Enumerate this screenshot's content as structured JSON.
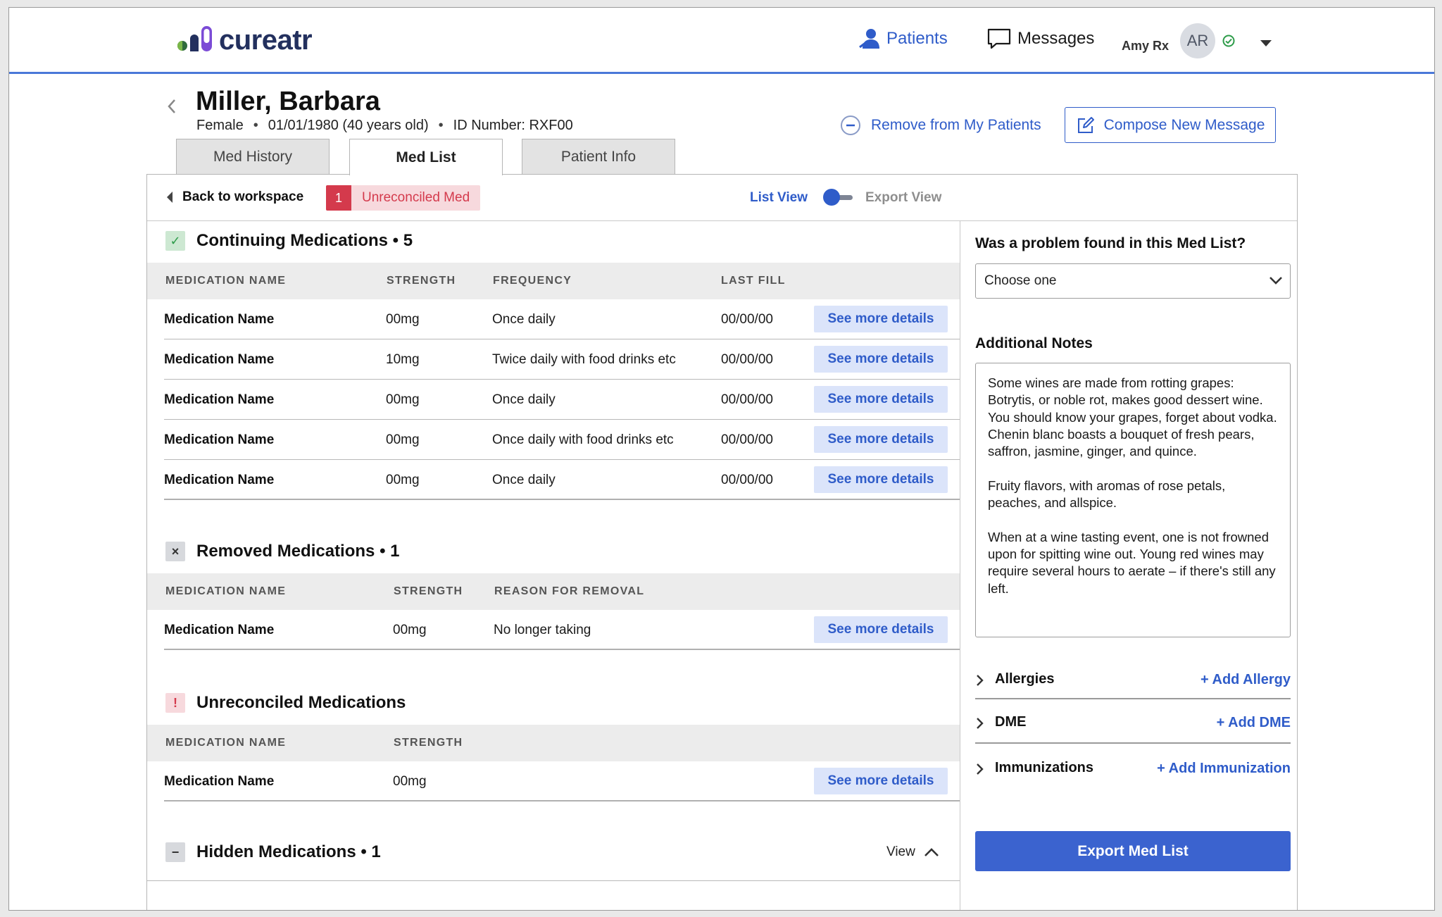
{
  "brand": {
    "name": "cureatr"
  },
  "nav": {
    "patients": "Patients",
    "messages": "Messages",
    "user_name": "Amy Rx",
    "avatar_initials": "AR",
    "status_color": "#2e9c4a"
  },
  "patient": {
    "name": "Miller, Barbara",
    "sex": "Female",
    "dob": "01/01/1980 (40 years old)",
    "id": "ID Number: RXF00",
    "remove_label": "Remove from My Patients",
    "compose_label": "Compose New Message"
  },
  "tabs": [
    {
      "label": "Med History",
      "active": false
    },
    {
      "label": "Med List",
      "active": true
    },
    {
      "label": "Patient Info",
      "active": false
    }
  ],
  "toolbar": {
    "back_label": "Back to workspace",
    "unreconciled_count": "1",
    "unreconciled_label": "Unreconciled Med",
    "list_view": "List View",
    "export_view": "Export View"
  },
  "continuing": {
    "title": "Continuing Medications • 5",
    "headers": [
      "MEDICATION NAME",
      "STRENGTH",
      "FREQUENCY",
      "LAST FILL"
    ],
    "rows": [
      {
        "name": "Medication Name",
        "strength": "00mg",
        "frequency": "Once daily",
        "last_fill": "00/00/00",
        "action": "See more details"
      },
      {
        "name": "Medication Name",
        "strength": "10mg",
        "frequency": "Twice daily with food drinks etc",
        "last_fill": "00/00/00",
        "action": "See more details"
      },
      {
        "name": "Medication Name",
        "strength": "00mg",
        "frequency": "Once daily",
        "last_fill": "00/00/00",
        "action": "See more details"
      },
      {
        "name": "Medication Name",
        "strength": "00mg",
        "frequency": "Once daily with food drinks etc",
        "last_fill": "00/00/00",
        "action": "See more details"
      },
      {
        "name": "Medication Name",
        "strength": "00mg",
        "frequency": "Once daily",
        "last_fill": "00/00/00",
        "action": "See more details"
      }
    ]
  },
  "removed": {
    "title": "Removed Medications • 1",
    "headers": [
      "MEDICATION NAME",
      "STRENGTH",
      "REASON FOR REMOVAL"
    ],
    "rows": [
      {
        "name": "Medication Name",
        "strength": "00mg",
        "reason": "No longer taking",
        "action": "See more details"
      }
    ]
  },
  "unreconciled": {
    "title": "Unreconciled Medications",
    "headers": [
      "MEDICATION NAME",
      "STRENGTH"
    ],
    "rows": [
      {
        "name": "Medication Name",
        "strength": "00mg",
        "action": "See more details"
      }
    ]
  },
  "hidden": {
    "title": "Hidden Medications • 1",
    "view_label": "View"
  },
  "sidebar": {
    "question": "Was a problem found in this Med List?",
    "select_value": "Choose one",
    "notes_label": "Additional Notes",
    "notes_text": "Some wines are made from rotting grapes: Botrytis, or noble rot, makes good dessert wine. You should know your grapes, forget about vodka. Chenin blanc boasts a bouquet of fresh pears, saffron, jasmine, ginger, and quince.\n\nFruity flavors, with aromas of rose petals, peaches, and allspice.\n\nWhen at a wine tasting event, one is not frowned upon for spitting wine out. Young red wines may require several hours to aerate – if there's still any left.",
    "accordions": [
      {
        "label": "Allergies",
        "add": "+ Add Allergy"
      },
      {
        "label": "DME",
        "add": "+ Add DME"
      },
      {
        "label": "Immunizations",
        "add": "+ Add Immunization"
      }
    ],
    "export_label": "Export Med List"
  },
  "colors": {
    "accent": "#2f5cc9",
    "alert": "#d43a4c",
    "success": "#2e9c4a",
    "export_button": "#3b63cf"
  }
}
